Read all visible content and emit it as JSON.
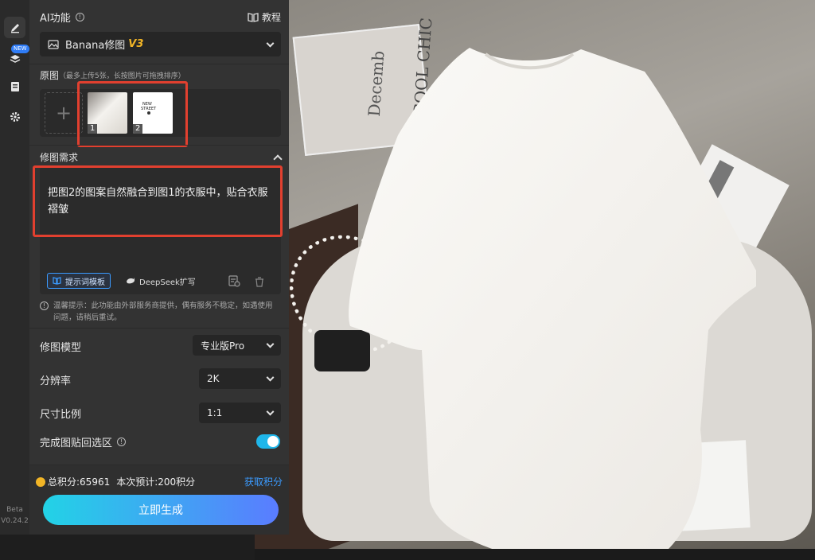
{
  "rail": {
    "version_line1": "Beta",
    "version_line2": "V0.24.2",
    "new_badge": "NEW",
    "icons": [
      "pen-icon",
      "layers-icon",
      "document-icon",
      "gear-icon"
    ]
  },
  "header": {
    "title": "AI功能",
    "tutorial_label": "教程"
  },
  "mode_select": {
    "value": "Banana修图",
    "version": "V3"
  },
  "images": {
    "label": "原图",
    "hint": "（最多上传5张，长按图片可拖拽排序）",
    "thumbnails": [
      {
        "index": "1"
      },
      {
        "index": "2"
      }
    ]
  },
  "requirements": {
    "label": "修图需求",
    "prompt": "把图2的图案自然融合到图1的衣服中，贴合衣服褶皱",
    "template_chip": "提示词模板",
    "deepseek_chip": "DeepSeek扩写",
    "notice": "温馨提示：此功能由外部服务商提供，偶有服务不稳定，如遇使用问题，请稍后重试。"
  },
  "settings": {
    "model_label": "修图模型",
    "model_value": "专业版Pro",
    "resolution_label": "分辨率",
    "resolution_value": "2K",
    "ratio_label": "尺寸比例",
    "ratio_value": "1:1",
    "paste_back_label": "完成图贴回选区",
    "paste_back_on": true
  },
  "footer": {
    "total_points": "总积分:65961",
    "estimate": "本次预计:200积分",
    "get_points": "获取积分",
    "generate_button": "立即生成"
  },
  "colors": {
    "accent_cyan": "#22d3e6",
    "accent_blue": "#5a7cff",
    "highlight_red": "#e2402f",
    "link_blue": "#3b9bff"
  }
}
